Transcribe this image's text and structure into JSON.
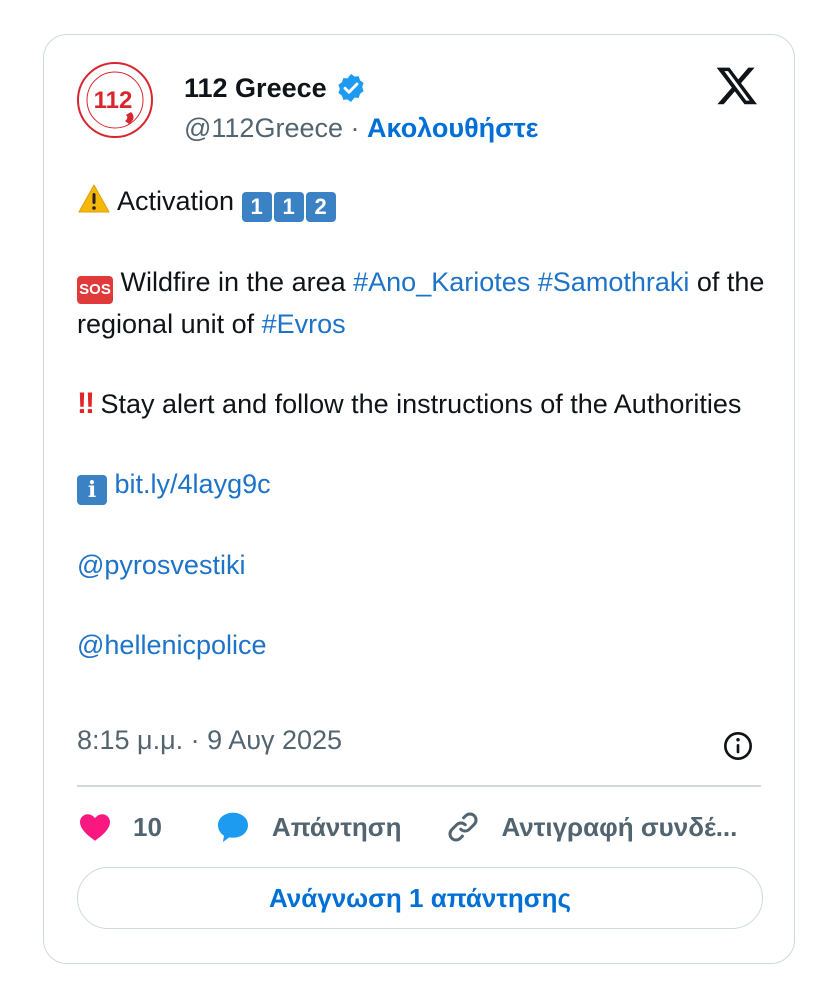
{
  "author": {
    "name": "112 Greece",
    "handle": "@112Greece",
    "separator": "·",
    "follow_label": "Ακολουθήστε",
    "verified": true,
    "avatar_text": "112"
  },
  "tweet": {
    "line1": {
      "emoji": "warning-icon",
      "text": "Activation",
      "digits": [
        "1",
        "1",
        "2"
      ]
    },
    "line2": {
      "emoji_label": "SOS",
      "text": "Wildfire in the area",
      "tags": [
        "#Ano_Kariotes",
        "#Samothraki"
      ],
      "text2": "of the regional unit of",
      "tag3": "#Evros"
    },
    "line3": {
      "emoji": "!!",
      "text": "Stay alert and follow the instructions of the Authorities"
    },
    "line4": {
      "emoji_label": "i",
      "link": "bit.ly/4layg9c"
    },
    "mention1": "@pyrosvestiki",
    "mention2": "@hellenicpolice"
  },
  "timestamp": "8:15 μ.μ. · 9 Αυγ 2025",
  "actions": {
    "like_count": "10",
    "reply_label": "Απάντηση",
    "copy_label": "Αντιγραφή συνδέ..."
  },
  "read_replies_label": "Ανάγνωση 1 απάντησης",
  "colors": {
    "link": "#1d73c7",
    "accent": "#006fd6",
    "like": "#f91880",
    "border": "#cfd9de",
    "muted": "#536471"
  }
}
